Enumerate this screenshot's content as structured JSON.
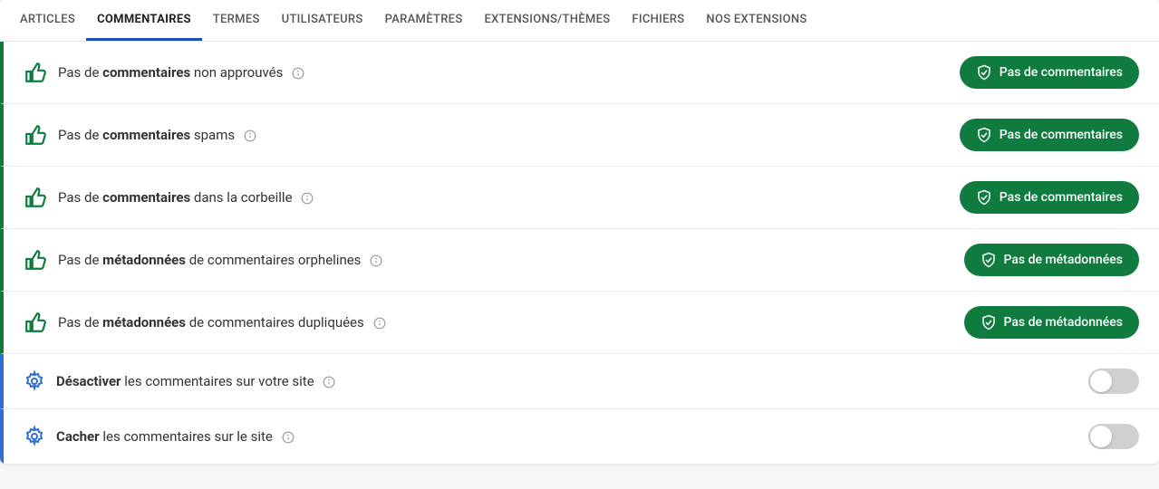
{
  "tabs": [
    {
      "label": "ARTICLES",
      "active": false
    },
    {
      "label": "COMMENTAIRES",
      "active": true
    },
    {
      "label": "TERMES",
      "active": false
    },
    {
      "label": "UTILISATEURS",
      "active": false
    },
    {
      "label": "PARAMÈTRES",
      "active": false
    },
    {
      "label": "EXTENSIONS/THÈMES",
      "active": false
    },
    {
      "label": "FICHIERS",
      "active": false
    },
    {
      "label": "NOS EXTENSIONS",
      "active": false
    }
  ],
  "rows": [
    {
      "type": "status",
      "prefix": "Pas de ",
      "bold": "commentaires",
      "suffix": " non approuvés",
      "badge": "Pas de commentaires"
    },
    {
      "type": "status",
      "prefix": "Pas de ",
      "bold": "commentaires",
      "suffix": " spams",
      "badge": "Pas de commentaires"
    },
    {
      "type": "status",
      "prefix": "Pas de ",
      "bold": "commentaires",
      "suffix": " dans la corbeille",
      "badge": "Pas de commentaires"
    },
    {
      "type": "status",
      "prefix": "Pas de ",
      "bold": "métadonnées",
      "suffix": " de commentaires orphelines",
      "badge": "Pas de métadonnées"
    },
    {
      "type": "status",
      "prefix": "Pas de ",
      "bold": "métadonnées",
      "suffix": " de commentaires dupliquées",
      "badge": "Pas de métadonnées"
    },
    {
      "type": "setting",
      "bold": "Désactiver",
      "suffix": " les commentaires sur votre site",
      "toggle": false
    },
    {
      "type": "setting",
      "bold": "Cacher",
      "suffix": " les commentaires sur le site",
      "toggle": false
    }
  ]
}
